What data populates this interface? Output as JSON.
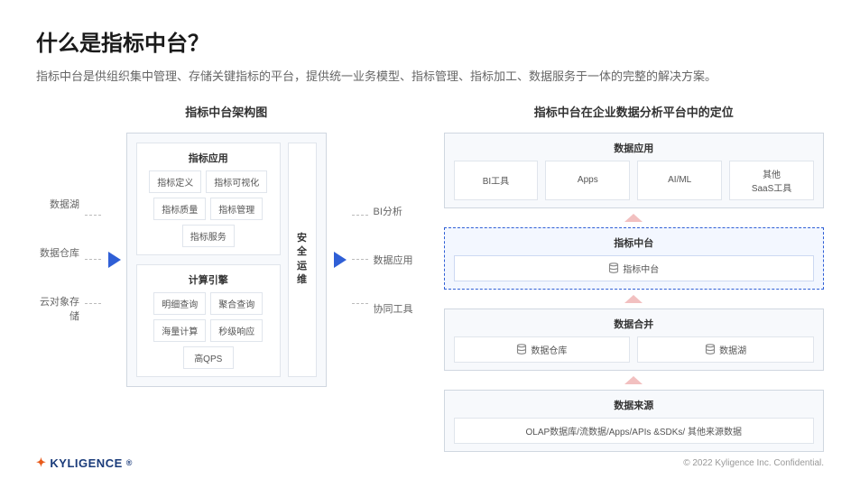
{
  "title": "什么是指标中台？",
  "subtitle": "指标中台是供组织集中管理、存储关键指标的平台，提供统一业务模型、指标管理、指标加工、数据服务于一体的完整的解决方案。",
  "left": {
    "heading": "指标中台架构图",
    "sources": [
      "数据湖",
      "数据仓库",
      "云对象存储"
    ],
    "app_section": {
      "title": "指标应用",
      "items": [
        "指标定义",
        "指标可视化",
        "指标质量",
        "指标管理",
        "指标服务"
      ]
    },
    "engine_section": {
      "title": "计算引擎",
      "items": [
        "明细查询",
        "聚合查询",
        "海量计算",
        "秒级响应",
        "高QPS"
      ]
    },
    "security": "安全\n运维",
    "outputs": [
      "BI分析",
      "数据应用",
      "协同工具"
    ]
  },
  "right": {
    "heading": "指标中台在企业数据分析平台中的定位",
    "layer1": {
      "title": "数据应用",
      "items": [
        "BI工具",
        "Apps",
        "AI/ML",
        "其他\nSaaS工具"
      ]
    },
    "layer2": {
      "title": "指标中台",
      "item": "指标中台"
    },
    "layer3": {
      "title": "数据合并",
      "items": [
        "数据仓库",
        "数据湖"
      ]
    },
    "layer4": {
      "title": "数据来源",
      "item": "OLAP数据库/流数据/Apps/APIs &SDKs/ 其他来源数据"
    }
  },
  "footer": {
    "logo": "KYLIGENCE",
    "copyright": "© 2022 Kyligence Inc. Confidential."
  }
}
